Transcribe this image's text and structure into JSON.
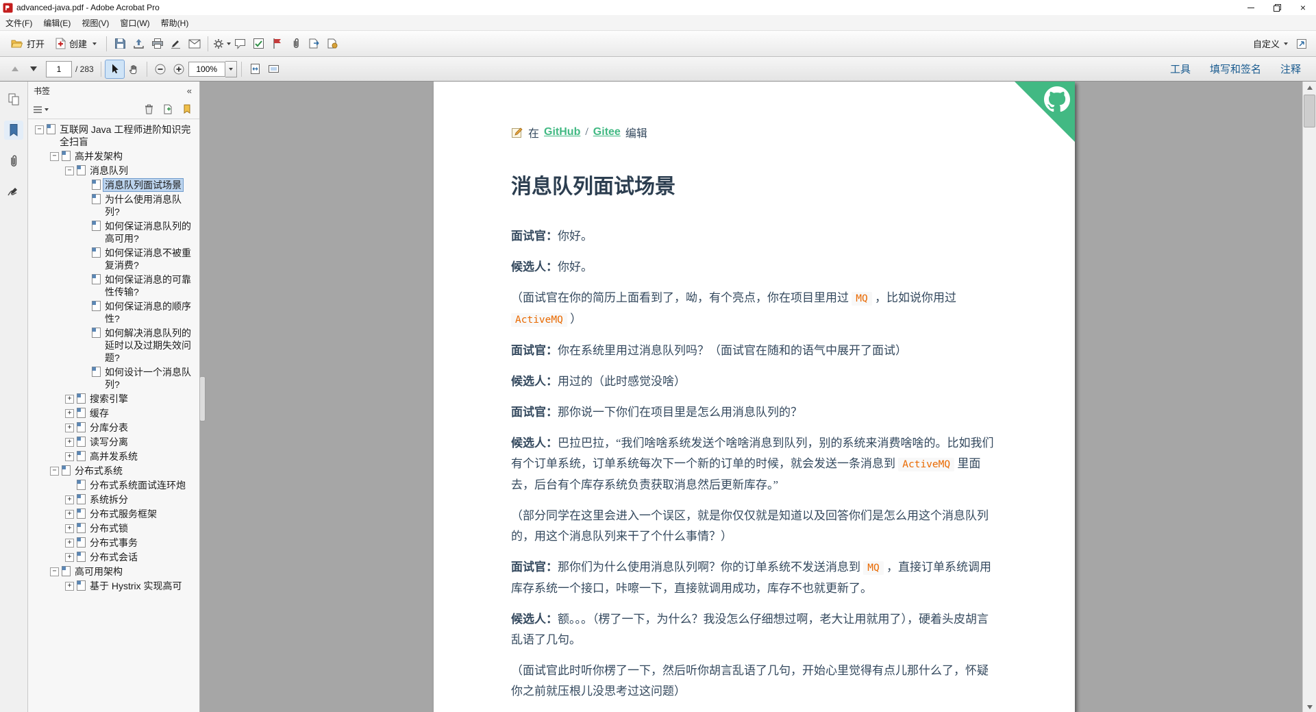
{
  "window": {
    "title": "advanced-java.pdf - Adobe Acrobat Pro"
  },
  "menu": {
    "items": [
      "文件(F)",
      "编辑(E)",
      "视图(V)",
      "窗口(W)",
      "帮助(H)"
    ]
  },
  "toolbar": {
    "open_label": "打开",
    "create_label": "创建",
    "customize_label": "自定义",
    "icon_names": [
      "folder-open-icon",
      "create-pdf-icon",
      "save-icon",
      "share-icon",
      "print-icon",
      "sign-icon",
      "email-icon",
      "gear-icon",
      "comment-icon",
      "review-check-icon",
      "flag-icon",
      "attachment-icon",
      "export-icon",
      "certify-icon",
      "expand-tools-icon"
    ]
  },
  "nav": {
    "page_value": "1",
    "page_total": "/ 283",
    "zoom_value": "100%",
    "tools_label": "工具",
    "fill_sign_label": "填写和签名",
    "comment_label": "注释",
    "icon_names": [
      "prev-page-icon",
      "next-page-icon",
      "select-tool-icon",
      "hand-tool-icon",
      "zoom-out-icon",
      "zoom-in-icon",
      "page-fit-icon",
      "page-width-icon"
    ]
  },
  "panel": {
    "title": "书签",
    "icon_names": [
      "bookmark-options-icon",
      "delete-bookmark-icon",
      "new-bookmark-icon",
      "highlight-bookmark-icon",
      "collapse-panel-icon"
    ]
  },
  "iconstrip": {
    "icon_names": [
      "page-thumbnails-icon",
      "bookmarks-icon",
      "attachments-icon",
      "signatures-icon"
    ]
  },
  "bookmarks": {
    "tree": [
      {
        "label": "互联网 Java 工程师进阶知识完全扫盲",
        "state": "expanded",
        "children": [
          {
            "label": "高并发架构",
            "state": "expanded",
            "children": [
              {
                "label": "消息队列",
                "state": "expanded",
                "children": [
                  {
                    "label": "消息队列面试场景",
                    "state": "leaf",
                    "selected": true
                  },
                  {
                    "label": "为什么使用消息队列?",
                    "state": "leaf"
                  },
                  {
                    "label": "如何保证消息队列的高可用?",
                    "state": "leaf"
                  },
                  {
                    "label": "如何保证消息不被重复消费?",
                    "state": "leaf"
                  },
                  {
                    "label": "如何保证消息的可靠性传输?",
                    "state": "leaf"
                  },
                  {
                    "label": "如何保证消息的顺序性?",
                    "state": "leaf"
                  },
                  {
                    "label": "如何解决消息队列的延时以及过期失效问题?",
                    "state": "leaf"
                  },
                  {
                    "label": "如何设计一个消息队列?",
                    "state": "leaf"
                  }
                ]
              },
              {
                "label": "搜索引擎",
                "state": "collapsed"
              },
              {
                "label": "缓存",
                "state": "collapsed"
              },
              {
                "label": "分库分表",
                "state": "collapsed"
              },
              {
                "label": "读写分离",
                "state": "collapsed"
              },
              {
                "label": "高并发系统",
                "state": "collapsed"
              }
            ]
          },
          {
            "label": "分布式系统",
            "state": "expanded",
            "children": [
              {
                "label": "分布式系统面试连环炮",
                "state": "leaf"
              },
              {
                "label": "系统拆分",
                "state": "collapsed"
              },
              {
                "label": "分布式服务框架",
                "state": "collapsed"
              },
              {
                "label": "分布式锁",
                "state": "collapsed"
              },
              {
                "label": "分布式事务",
                "state": "collapsed"
              },
              {
                "label": "分布式会话",
                "state": "collapsed"
              }
            ]
          },
          {
            "label": "高可用架构",
            "state": "expanded",
            "children": [
              {
                "label": "基于 Hystrix 实现高可",
                "state": "collapsed"
              }
            ]
          }
        ]
      }
    ]
  },
  "doc": {
    "edit_prefix": "在",
    "github_label": "GitHub",
    "slash": "/",
    "gitee_label": "Gitee",
    "edit_suffix": "编辑",
    "heading": "消息队列面试场景",
    "paragraphs": [
      [
        {
          "b": "面试官："
        },
        {
          "t": "你好。"
        }
      ],
      [
        {
          "b": "候选人："
        },
        {
          "t": "你好。"
        }
      ],
      [
        {
          "t": "（面试官在你的简历上面看到了，呦，有个亮点，你在项目里用过 "
        },
        {
          "c": "MQ"
        },
        {
          "t": " ，比如说你用过 "
        },
        {
          "c": "ActiveMQ"
        },
        {
          "t": " ）"
        }
      ],
      [
        {
          "b": "面试官："
        },
        {
          "t": "你在系统里用过消息队列吗？（面试官在随和的语气中展开了面试）"
        }
      ],
      [
        {
          "b": "候选人："
        },
        {
          "t": "用过的（此时感觉没啥）"
        }
      ],
      [
        {
          "b": "面试官："
        },
        {
          "t": "那你说一下你们在项目里是怎么用消息队列的？"
        }
      ],
      [
        {
          "b": "候选人："
        },
        {
          "t": "巴拉巴拉，“我们啥啥系统发送个啥啥消息到队列，别的系统来消费啥啥的。比如我们有个订单系统，订单系统每次下一个新的订单的时候，就会发送一条消息到 "
        },
        {
          "c": "ActiveMQ"
        },
        {
          "t": " 里面去，后台有个库存系统负责获取消息然后更新库存。”"
        }
      ],
      [
        {
          "t": "（部分同学在这里会进入一个误区，就是你仅仅就是知道以及回答你们是怎么用这个消息队列的，用这个消息队列来干了个什么事情？）"
        }
      ],
      [
        {
          "b": "面试官："
        },
        {
          "t": "那你们为什么使用消息队列啊？你的订单系统不发送消息到 "
        },
        {
          "c": "MQ"
        },
        {
          "t": " ，直接订单系统调用库存系统一个接口，咔嚓一下，直接就调用成功，库存不也就更新了。"
        }
      ],
      [
        {
          "b": "候选人："
        },
        {
          "t": "额。。。（楞了一下，为什么？我没怎么仔细想过啊，老大让用就用了），硬着头皮胡言乱语了几句。"
        }
      ],
      [
        {
          "t": "（面试官此时听你楞了一下，然后听你胡言乱语了几句，开始心里觉得有点儿那什么了，怀疑你之前就压根儿没思考过这问题）"
        }
      ]
    ]
  },
  "colors": {
    "accent_green": "#42b983",
    "code_orange": "#e96900",
    "heading": "#2c3e50",
    "body_text": "#34495e",
    "selection_blue": "#bcd4ee",
    "canvas_gray": "#a6a6a6"
  }
}
